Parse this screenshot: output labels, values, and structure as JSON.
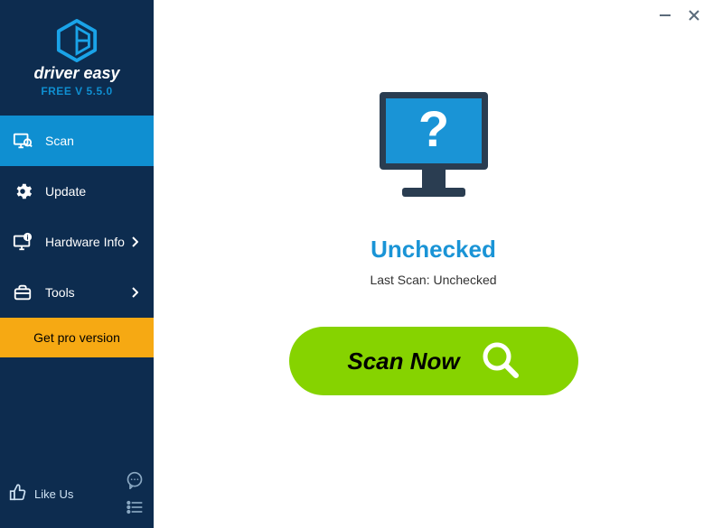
{
  "app": {
    "name": "driver easy",
    "version_label": "FREE V 5.5.0"
  },
  "sidebar": {
    "items": [
      {
        "label": "Scan"
      },
      {
        "label": "Update"
      },
      {
        "label": "Hardware Info"
      },
      {
        "label": "Tools"
      }
    ],
    "pro_label": "Get pro version",
    "like_label": "Like Us"
  },
  "main": {
    "status_title": "Unchecked",
    "last_scan_label": "Last Scan: Unchecked",
    "scan_button_label": "Scan Now"
  }
}
